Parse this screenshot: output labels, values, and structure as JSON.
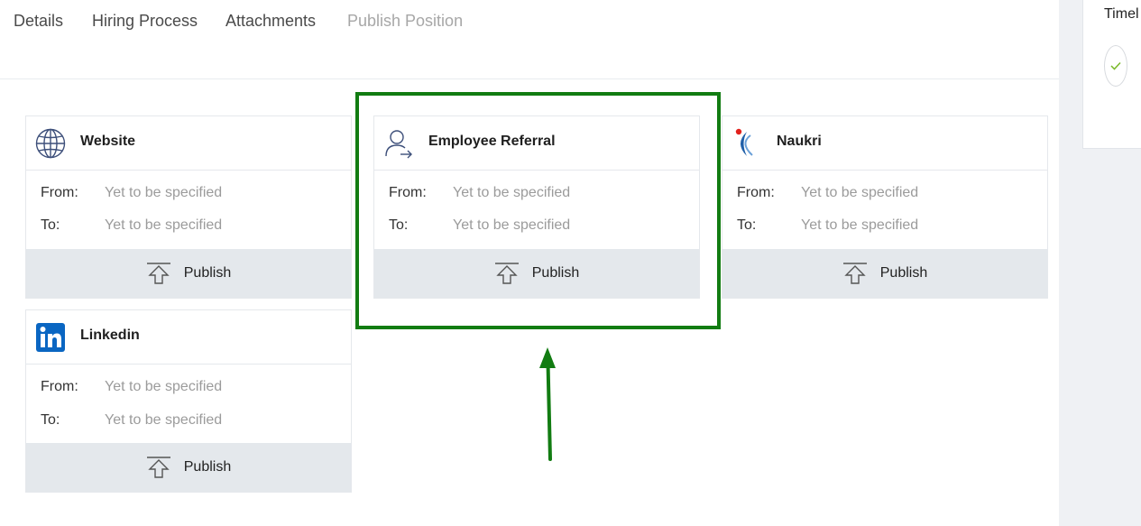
{
  "tabs": [
    {
      "label": "Details"
    },
    {
      "label": "Hiring Process"
    },
    {
      "label": "Attachments"
    },
    {
      "label": "Publish Position"
    }
  ],
  "timeline": {
    "title": "Timel"
  },
  "channels": [
    {
      "name": "Website",
      "icon": "globe-icon",
      "from_label": "From:",
      "from_value": "Yet to be specified",
      "to_label": "To:",
      "to_value": "Yet to be specified",
      "action": "Publish"
    },
    {
      "name": "Employee Referral",
      "icon": "user-referral-icon",
      "from_label": "From:",
      "from_value": "Yet to be specified",
      "to_label": "To:",
      "to_value": "Yet to be specified",
      "action": "Publish"
    },
    {
      "name": "Naukri",
      "icon": "naukri-logo-icon",
      "from_label": "From:",
      "from_value": "Yet to be specified",
      "to_label": "To:",
      "to_value": "Yet to be specified",
      "action": "Publish"
    },
    {
      "name": "Linkedin",
      "icon": "linkedin-logo-icon",
      "from_label": "From:",
      "from_value": "Yet to be specified",
      "to_label": "To:",
      "to_value": "Yet to be specified",
      "action": "Publish"
    }
  ],
  "annotation": {
    "highlight_color": "#127c12"
  },
  "colors": {
    "linkedin": "#0a66c2",
    "naukri_red": "#e2211c",
    "naukri_blue": "#1f5fa8",
    "check_green": "#7ab929"
  }
}
